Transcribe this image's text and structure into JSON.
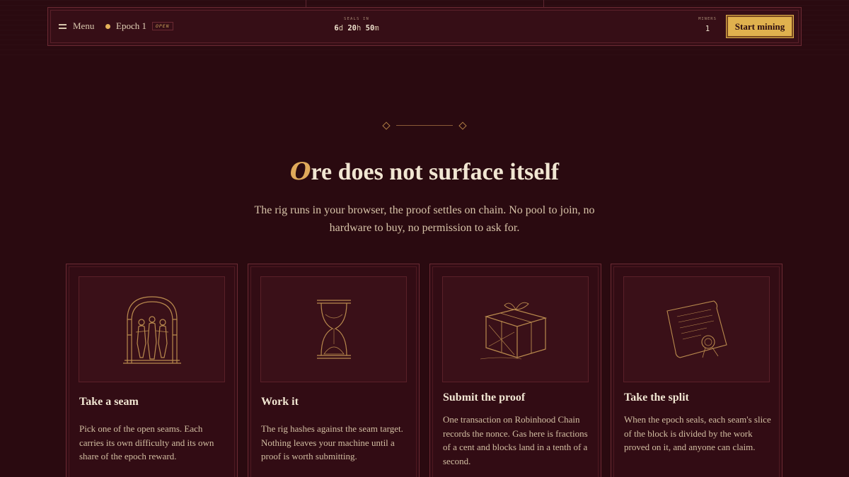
{
  "topbar": {
    "menu_label": "Menu",
    "epoch_label": "Epoch 1",
    "epoch_status": "OPEN",
    "seals_label": "SEALS IN",
    "countdown": {
      "days": "6",
      "hours": "20",
      "minutes": "50",
      "day_unit": "d",
      "hour_unit": "h",
      "minute_unit": "m"
    },
    "miners_label": "MINERS",
    "miners_count": "1",
    "start_button": "Start mining"
  },
  "section": {
    "dropcap": "O",
    "title_rest": "re does not surface itself",
    "lede": "The rig runs in your browser, the proof settles on chain. No pool to join, no hardware to buy, no permission to ask for."
  },
  "cards": [
    {
      "title": "Take a seam",
      "text": "Pick one of the open seams. Each carries its own difficulty and its own share of the epoch reward.",
      "icon": "archway-figures-icon"
    },
    {
      "title": "Work it",
      "text": "The rig hashes against the seam target. Nothing leaves your machine until a proof is worth submitting.",
      "icon": "hourglass-icon"
    },
    {
      "title": "Submit the proof",
      "text": "One transaction on Robinhood Chain records the nonce. Gas here is fractions of a cent and blocks land in a tenth of a second.",
      "icon": "wrapped-parcel-icon"
    },
    {
      "title": "Take the split",
      "text": "When the epoch seals, each seam's slice of the block is divided by the work proved on it, and anyone can claim.",
      "icon": "sealed-letter-icon"
    }
  ],
  "colors": {
    "background": "#2a0a10",
    "accent": "#e0b14e",
    "line": "#6b2a33"
  }
}
